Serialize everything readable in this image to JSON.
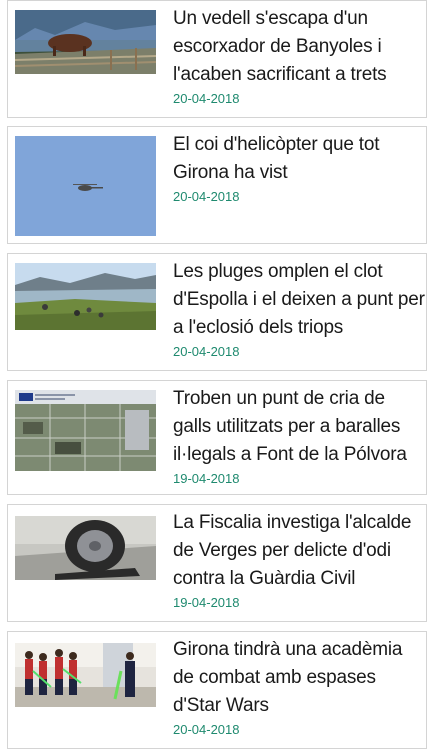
{
  "articles": [
    {
      "title": "Un vedell s'escapa d'un escorxador de Banyoles i l'acaben sacrificant a trets",
      "date": "20-04-2018"
    },
    {
      "title": "El coi d'helicòpter que tot Girona ha vist",
      "date": "20-04-2018"
    },
    {
      "title": "Les pluges omplen el clot d'Espolla i el deixen a punt per a l'eclosió dels triops",
      "date": "20-04-2018"
    },
    {
      "title": "Troben un punt de cria de galls utilitzats per a baralles il·legals a Font de la Pólvora",
      "date": "19-04-2018"
    },
    {
      "title": "La Fiscalia investiga l'alcalde de Verges per delicte d'odi contra la Guàrdia Civil",
      "date": "19-04-2018"
    },
    {
      "title": "Girona tindrà una acadèmia de combat amb espases d'Star Wars",
      "date": "20-04-2018"
    }
  ],
  "colors": {
    "date": "#1f8a6f",
    "title": "#1a1a1a",
    "border": "#d4d4d4"
  }
}
